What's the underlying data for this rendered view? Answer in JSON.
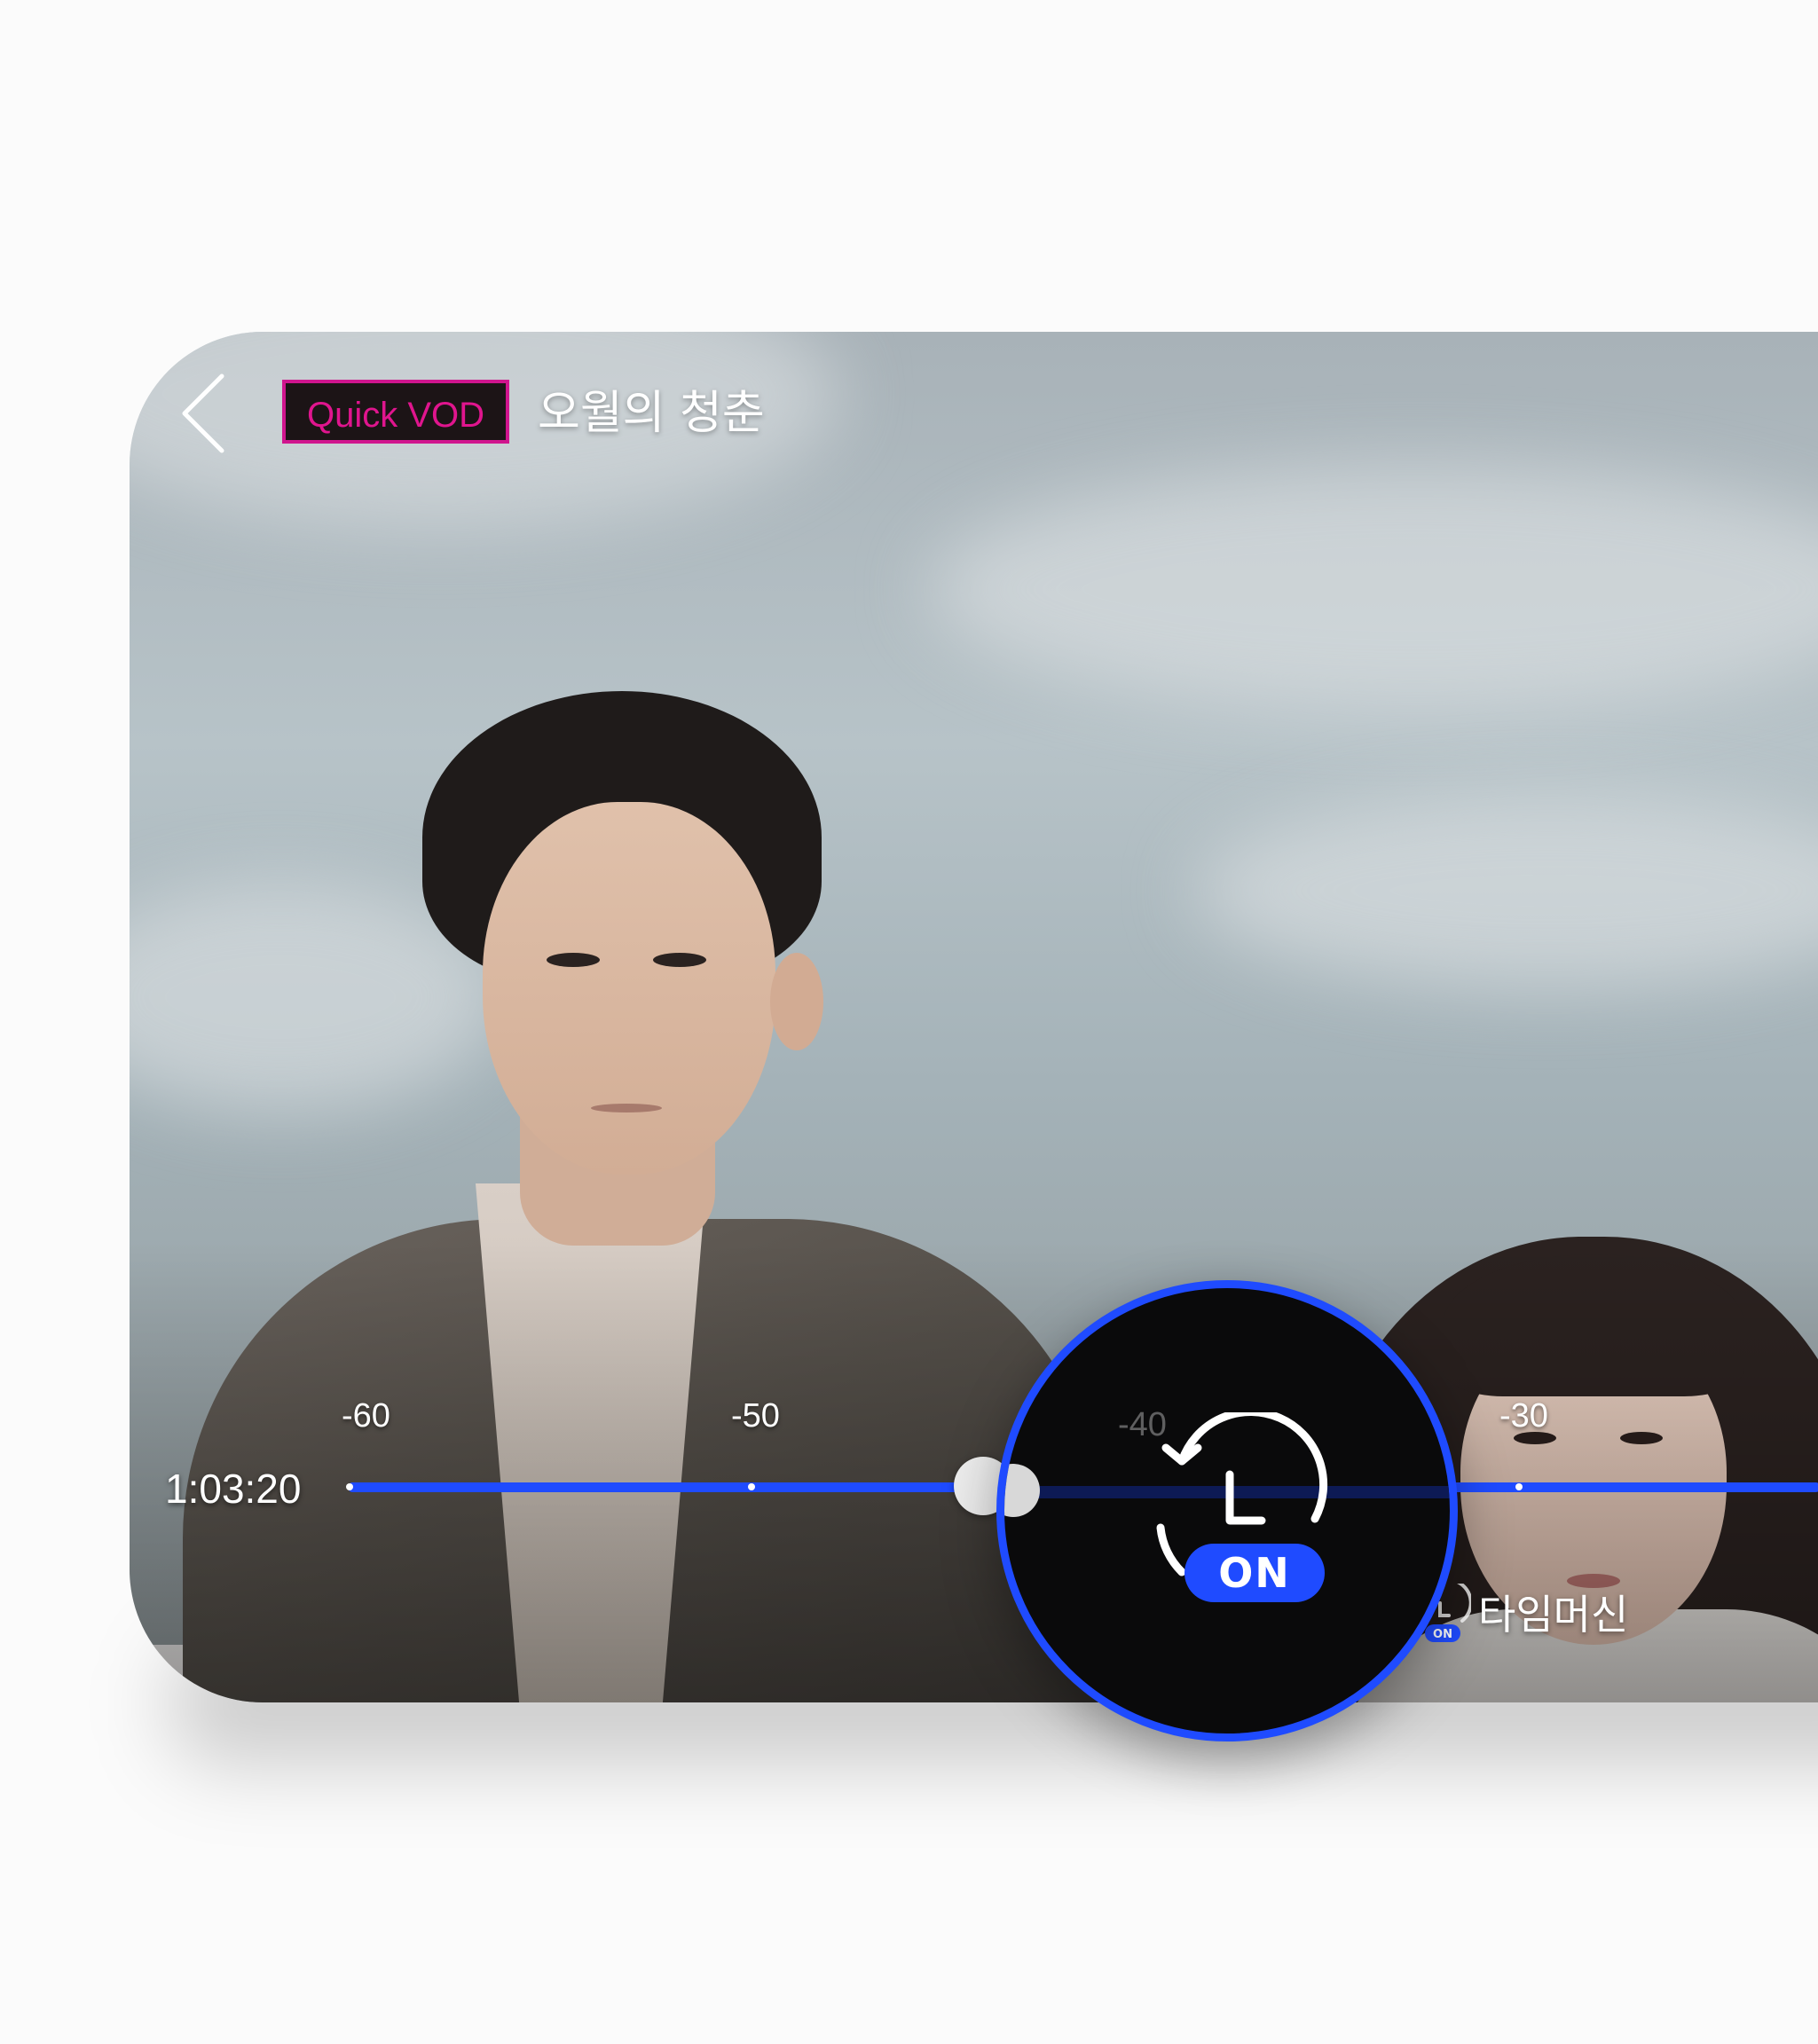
{
  "header": {
    "back_icon": "chevron-left-icon",
    "badge_label": "Quick VOD",
    "title": "오월의 청춘"
  },
  "timeline": {
    "current_time": "1:03:20",
    "ticks": [
      "-60",
      "-50",
      "-40",
      "-30"
    ],
    "accent_color": "#1f4bff"
  },
  "timemachine": {
    "label": "타임머신",
    "status": "ON",
    "icon": "history-clock-icon"
  },
  "magnifier": {
    "status": "ON",
    "faded_tick": "-40"
  },
  "colors": {
    "badge_border": "#d0158e",
    "badge_text": "#e0158e",
    "accent": "#1f4bff"
  }
}
